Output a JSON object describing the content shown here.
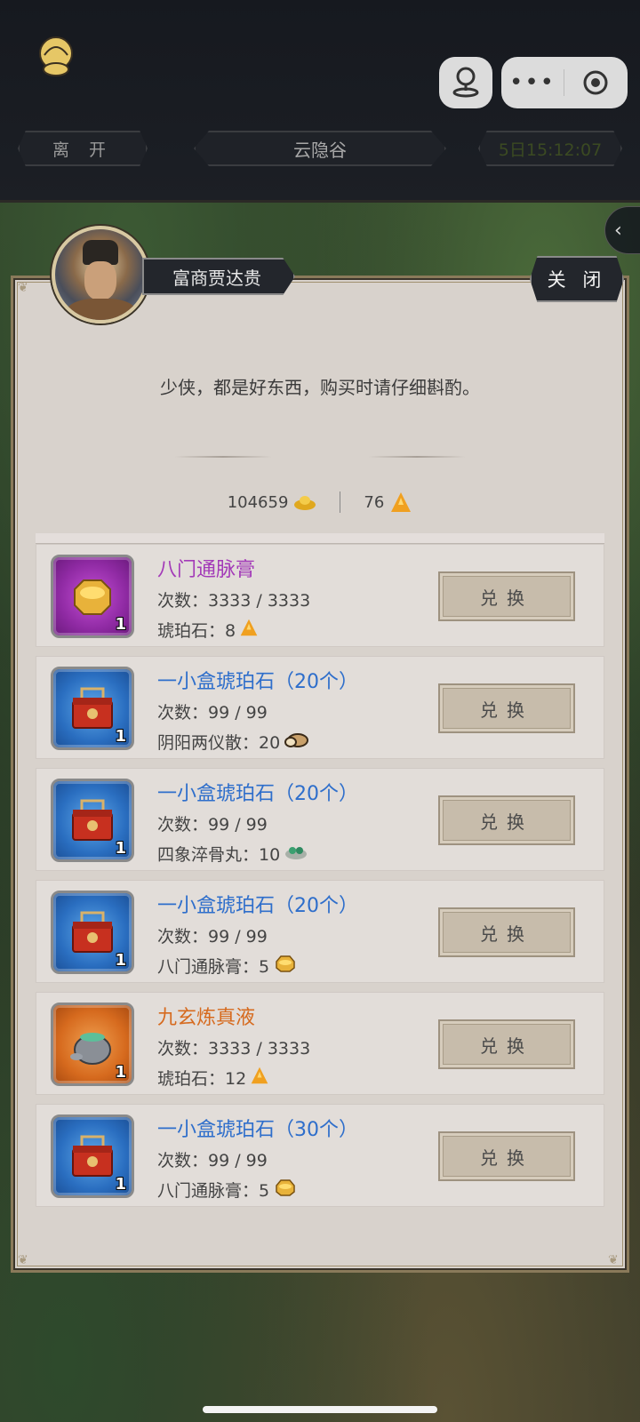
{
  "topbar": {
    "leave_label": "离 开",
    "location": "云隐谷",
    "timer": "5日15:12:07"
  },
  "merchant": {
    "name": "富商贾达贵",
    "close_label": "关 闭",
    "dialog": "少侠，都是好东西，购买时请仔细斟酌。"
  },
  "currency": {
    "silver": "104659",
    "amber": "76"
  },
  "items": [
    {
      "name": "八门通脉膏",
      "rarity": "purple",
      "qty": "1",
      "count": "次数：3333 / 3333",
      "cost": "琥珀石：8",
      "cost_icon": "amber-icon",
      "button": "兑换"
    },
    {
      "name": "一小盒琥珀石（20个）",
      "rarity": "blue",
      "qty": "1",
      "count": "次数：99 / 99",
      "cost": "阴阳两仪散：20",
      "cost_icon": "yinyang-powder-icon",
      "button": "兑换"
    },
    {
      "name": "一小盒琥珀石（20个）",
      "rarity": "blue",
      "qty": "1",
      "count": "次数：99 / 99",
      "cost": "四象淬骨丸：10",
      "cost_icon": "jade-pill-icon",
      "button": "兑换"
    },
    {
      "name": "一小盒琥珀石（20个）",
      "rarity": "blue",
      "qty": "1",
      "count": "次数：99 / 99",
      "cost": "八门通脉膏：5",
      "cost_icon": "ointment-box-icon",
      "button": "兑换"
    },
    {
      "name": "九玄炼真液",
      "rarity": "orange",
      "qty": "1",
      "count": "次数：3333 / 3333",
      "cost": "琥珀石：12",
      "cost_icon": "amber-icon",
      "button": "兑换"
    },
    {
      "name": "一小盒琥珀石（30个）",
      "rarity": "blue",
      "qty": "1",
      "count": "次数：99 / 99",
      "cost": "八门通脉膏：5",
      "cost_icon": "ointment-box-icon",
      "button": "兑换"
    }
  ],
  "colors": {
    "purple": "#a33ab8",
    "blue": "#2e6ecb",
    "orange": "#d66a1e",
    "panel": "#d8d2cc"
  }
}
